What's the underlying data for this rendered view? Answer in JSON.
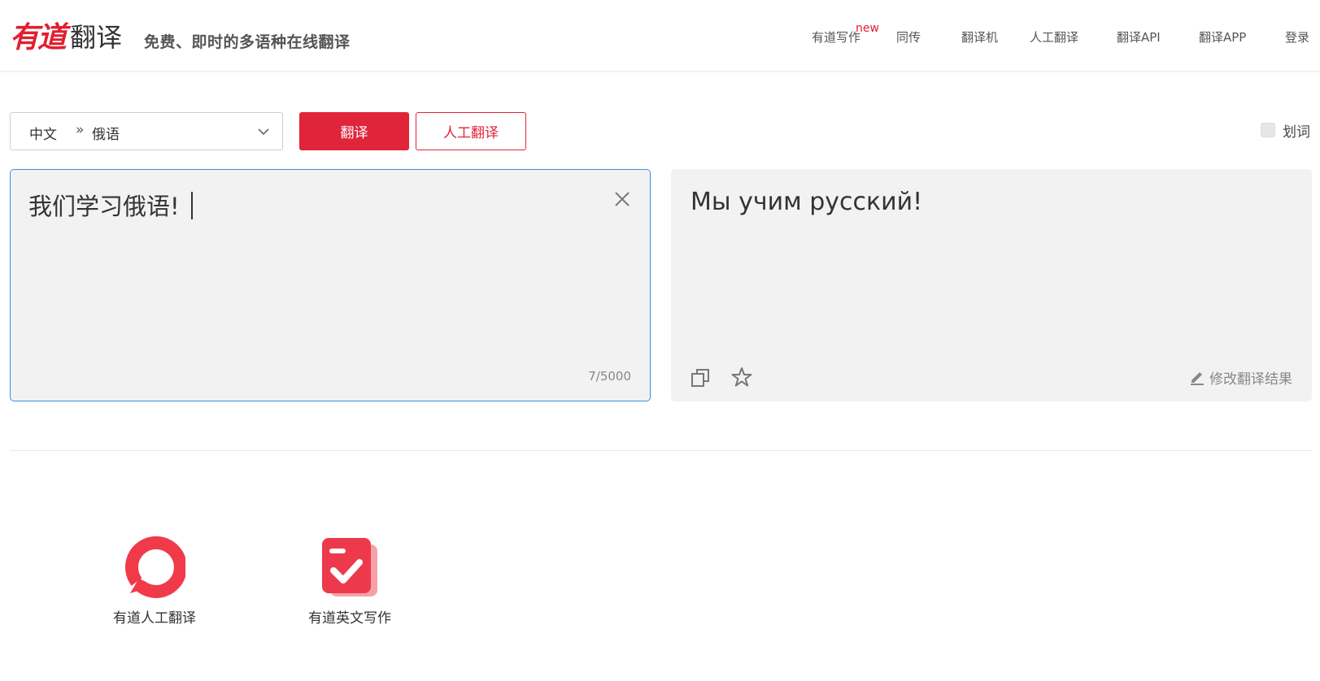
{
  "header": {
    "logo_brand": "有道",
    "logo_product": "翻译",
    "slogan": "免费、即时的多语种在线翻译",
    "nav": [
      {
        "label": "有道写作",
        "badge": "new"
      },
      {
        "label": "同传"
      },
      {
        "label": "翻译机"
      },
      {
        "label": "人工翻译"
      },
      {
        "label": "翻译API"
      },
      {
        "label": "翻译APP"
      },
      {
        "label": "登录"
      }
    ]
  },
  "toolbar": {
    "lang_from": "中文",
    "lang_arrow": "»",
    "lang_to": "俄语",
    "translate_label": "翻译",
    "human_translate_label": "人工翻译",
    "huaci_label": "划词"
  },
  "input": {
    "text": "我们学习俄语!",
    "count": "7/5000"
  },
  "output": {
    "text": "Мы учим русский!",
    "edit_label": "修改翻译结果"
  },
  "apps": [
    {
      "label": "有道人工翻译",
      "icon": "human-translate-app-icon"
    },
    {
      "label": "有道英文写作",
      "icon": "writing-app-icon"
    }
  ],
  "colors": {
    "brand_red": "#e0243a",
    "focus_blue": "#3c8ee0",
    "panel_bg": "#f2f2f2"
  }
}
